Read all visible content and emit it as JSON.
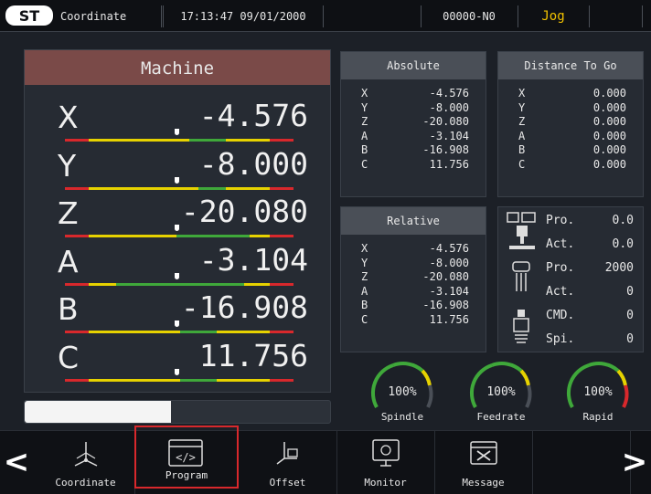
{
  "topbar": {
    "page_name": "Coordinate",
    "datetime": "17:13:47 09/01/2000",
    "program_no": "00000-N0",
    "mode": "Jog"
  },
  "machine": {
    "title": "Machine",
    "axes": [
      {
        "axis": "X",
        "value": "-4.576"
      },
      {
        "axis": "Y",
        "value": "-8.000"
      },
      {
        "axis": "Z",
        "value": "-20.080"
      },
      {
        "axis": "A",
        "value": "-3.104"
      },
      {
        "axis": "B",
        "value": "-16.908"
      },
      {
        "axis": "C",
        "value": "11.756"
      }
    ],
    "progress": 0.48
  },
  "absolute": {
    "title": "Absolute",
    "rows": [
      {
        "axis": "X",
        "value": "-4.576"
      },
      {
        "axis": "Y",
        "value": "-8.000"
      },
      {
        "axis": "Z",
        "value": "-20.080"
      },
      {
        "axis": "A",
        "value": "-3.104"
      },
      {
        "axis": "B",
        "value": "-16.908"
      },
      {
        "axis": "C",
        "value": "11.756"
      }
    ]
  },
  "distance_to_go": {
    "title": "Distance To Go",
    "rows": [
      {
        "axis": "X",
        "value": "0.000"
      },
      {
        "axis": "Y",
        "value": "0.000"
      },
      {
        "axis": "Z",
        "value": "0.000"
      },
      {
        "axis": "A",
        "value": "0.000"
      },
      {
        "axis": "B",
        "value": "0.000"
      },
      {
        "axis": "C",
        "value": "0.000"
      }
    ]
  },
  "relative": {
    "title": "Relative",
    "rows": [
      {
        "axis": "X",
        "value": "-4.576"
      },
      {
        "axis": "Y",
        "value": "-8.000"
      },
      {
        "axis": "Z",
        "value": "-20.080"
      },
      {
        "axis": "A",
        "value": "-3.104"
      },
      {
        "axis": "B",
        "value": "-16.908"
      },
      {
        "axis": "C",
        "value": "11.756"
      }
    ]
  },
  "status": {
    "rows": [
      {
        "label": "Pro.",
        "value": "0.0"
      },
      {
        "label": "Act.",
        "value": "0.0"
      },
      {
        "label": "Pro.",
        "value": "2000"
      },
      {
        "label": "Act.",
        "value": "0"
      },
      {
        "label": "CMD.",
        "value": "0"
      },
      {
        "label": "Spi.",
        "value": "0"
      }
    ]
  },
  "gauges": [
    {
      "label": "Spindle",
      "percent": "100%",
      "color": "#3fa83a"
    },
    {
      "label": "Feedrate",
      "percent": "100%",
      "color": "#3fa83a"
    },
    {
      "label": "Rapid",
      "percent": "100%",
      "color": "#3fa83a"
    }
  ],
  "nav": {
    "items": [
      {
        "label": "Coordinate",
        "icon": "axes-icon"
      },
      {
        "label": "Program",
        "icon": "code-icon"
      },
      {
        "label": "Offset",
        "icon": "offset-icon"
      },
      {
        "label": "Monitor",
        "icon": "monitor-icon"
      },
      {
        "label": "Message",
        "icon": "message-icon"
      }
    ],
    "prev": "<",
    "next": ">"
  },
  "colors": {
    "accent_yellow": "#f2c200",
    "machine_header": "#7a4a48",
    "selected_border": "#d8282c"
  }
}
